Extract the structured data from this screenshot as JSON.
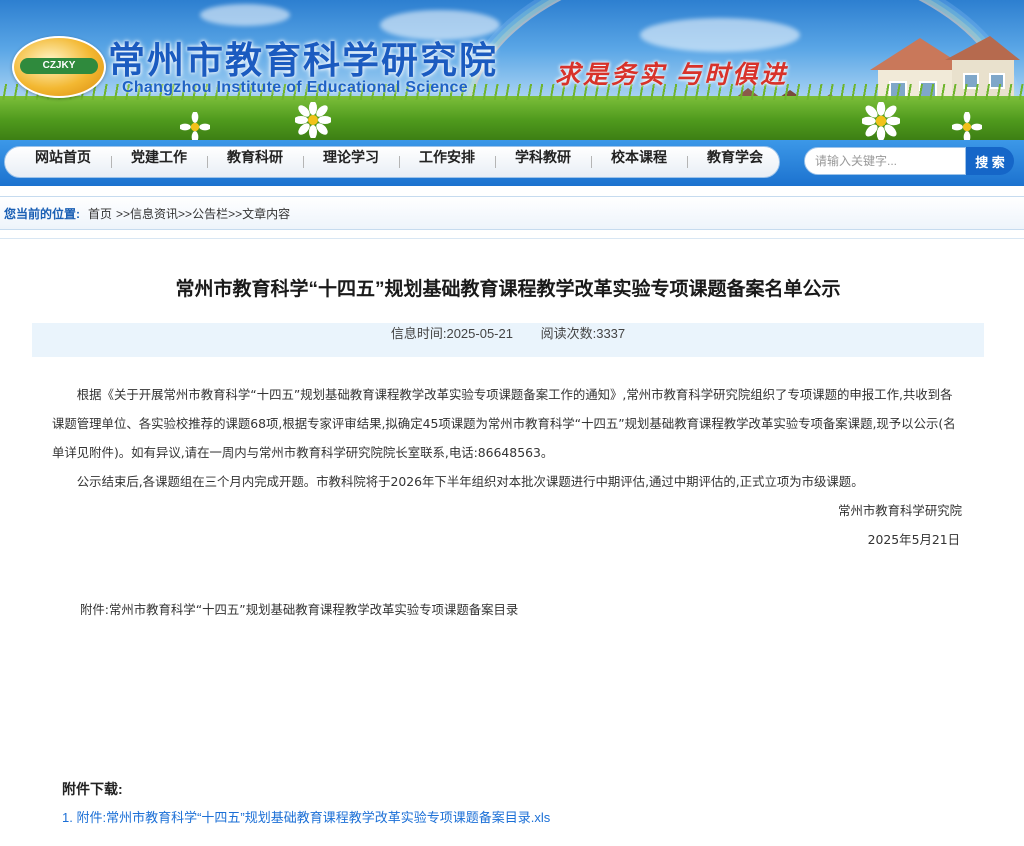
{
  "header": {
    "site_title": "常州市教育科学研究院",
    "site_subtitle": "Changzhou Institute of Educational Science",
    "logo_text": "CZJKY",
    "slogan": "求是务实  与时俱进"
  },
  "nav": {
    "items": [
      "网站首页",
      "党建工作",
      "教育科研",
      "理论学习",
      "工作安排",
      "学科教研",
      "校本课程",
      "教育学会"
    ],
    "search_placeholder": "请输入关键字...",
    "search_button": "搜 索"
  },
  "breadcrumb": {
    "label": "您当前的位置:",
    "items": [
      "首页",
      ">>信息资讯",
      ">>公告栏",
      ">>文章内容"
    ]
  },
  "article": {
    "title": "常州市教育科学“十四五”规划基础教育课程教学改革实验专项课题备案名单公示",
    "meta": {
      "time_label": "信息时间:",
      "time": "2025-05-21",
      "views_label": "阅读次数:",
      "views": "3337"
    },
    "paragraph1": "根据《关于开展常州市教育科学“十四五”规划基础教育课程教学改革实验专项课题备案工作的通知》,常州市教育科学研究院组织了专项课题的申报工作,共收到各课题管理单位、各实验校推荐的课题68项,根据专家评审结果,拟确定45项课题为常州市教育科学“十四五”规划基础教育课程教学改革实验专项备案课题,现予以公示(名单详见附件)。如有异议,请在一周内与常州市教育科学研究院院长室联系,电话:86648563。",
    "paragraph2": "公示结束后,各课题组在三个月内完成开题。市教科院将于2026年下半年组织对本批次课题进行中期评估,通过中期评估的,正式立项为市级课题。",
    "signature_org": "常州市教育科学研究院",
    "signature_date": "2025年5月21日",
    "attachment_note": "附件:常州市教育科学“十四五”规划基础教育课程教学改革实验专项课题备案目录"
  },
  "downloads": {
    "heading": "附件下载:",
    "items": [
      "1. 附件:常州市教育科学“十四五”规划基础教育课程教学改革实验专项课题备案目录.xls"
    ]
  },
  "colors": {
    "nav_blue": "#1c72cf",
    "title_blue": "#1b5bc0",
    "slogan_red": "#d8322a",
    "link_blue": "#1b6fd6"
  }
}
